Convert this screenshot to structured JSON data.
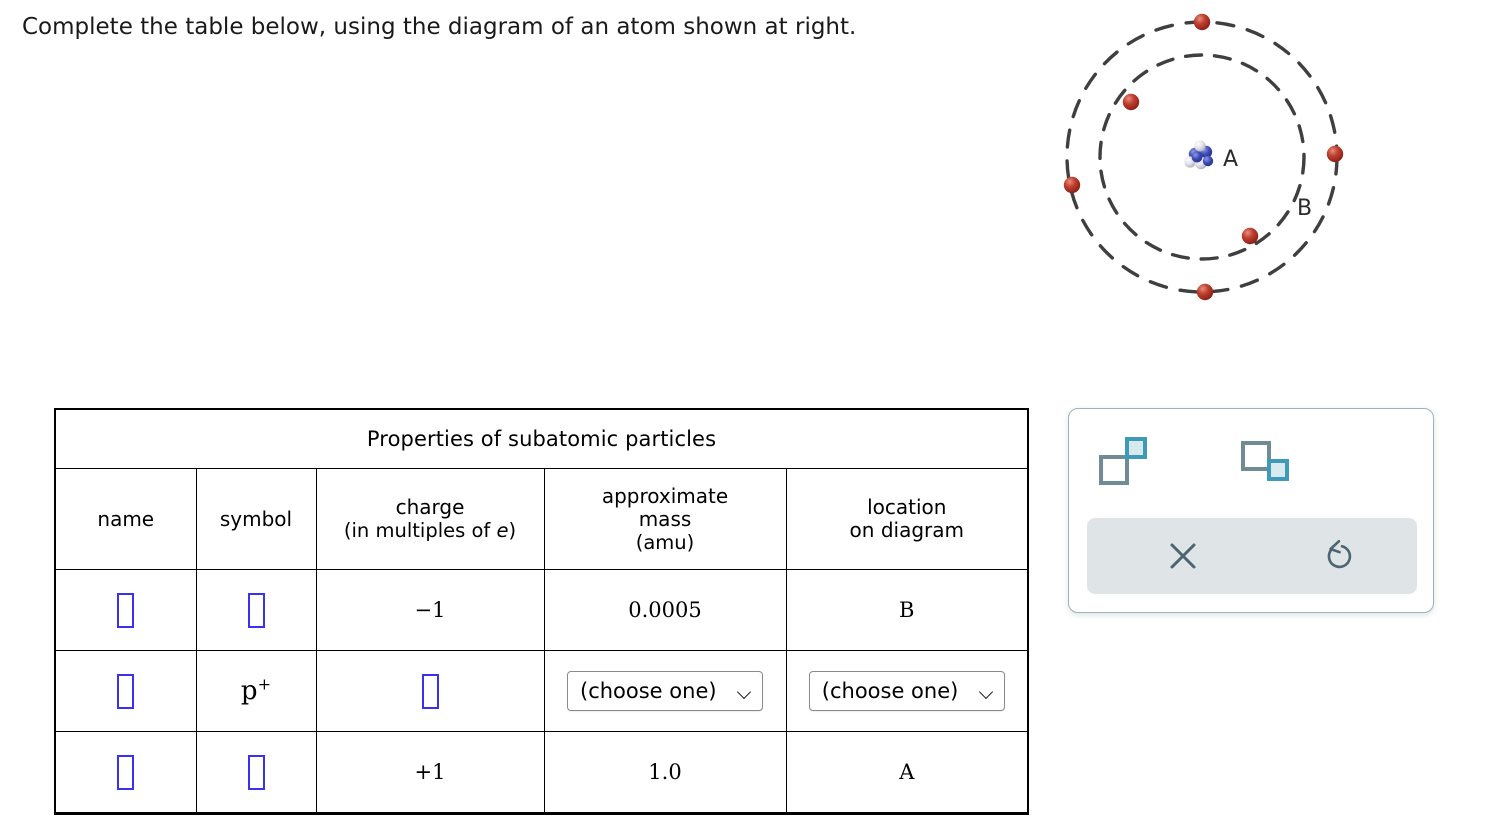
{
  "prompt": "Complete the table below, using the diagram of an atom shown at right.",
  "diagram": {
    "nucleus_label": "A",
    "shell_label": "B",
    "electron_color": "#b03224",
    "nucleus_color": "#3b49b5",
    "orbit_color": "#3f3f3f",
    "electrons_inner": 2,
    "electrons_outer": 4,
    "alt": "atom-diagram"
  },
  "table": {
    "title": "Properties of subatomic particles",
    "columns": [
      {
        "label": "name"
      },
      {
        "label": "symbol"
      },
      {
        "label": "charge",
        "sub": "(in multiples of ",
        "sub_italic": "e",
        "sub_end": ")"
      },
      {
        "label": "approximate",
        "label2": "mass",
        "sub": "(amu)"
      },
      {
        "label": "location",
        "label2": "on diagram"
      }
    ],
    "rows": [
      {
        "name": {
          "type": "input",
          "value": ""
        },
        "symbol": {
          "type": "input",
          "value": ""
        },
        "charge": {
          "type": "text",
          "value": "−1"
        },
        "mass": {
          "type": "text",
          "value": "0.0005"
        },
        "location": {
          "type": "text",
          "value": "B"
        }
      },
      {
        "name": {
          "type": "input",
          "value": ""
        },
        "symbol": {
          "type": "symbol",
          "base": "p",
          "sup": "+"
        },
        "charge": {
          "type": "input",
          "value": ""
        },
        "mass": {
          "type": "select",
          "value": "(choose one)"
        },
        "location": {
          "type": "select",
          "value": "(choose one)"
        }
      },
      {
        "name": {
          "type": "input",
          "value": ""
        },
        "symbol": {
          "type": "input",
          "value": ""
        },
        "charge": {
          "type": "text",
          "value": "+1"
        },
        "mass": {
          "type": "text",
          "value": "1.0"
        },
        "location": {
          "type": "text",
          "value": "A"
        }
      }
    ]
  },
  "palette": {
    "superscript_icon": "superscript-icon",
    "subscript_icon": "subscript-icon",
    "clear_icon": "close-icon",
    "undo_icon": "undo-icon",
    "accent": "#3d9ab8",
    "accent_fill": "#d6eaf0",
    "outline": "#6e8b96",
    "bar_bg": "#dfe5e7"
  }
}
